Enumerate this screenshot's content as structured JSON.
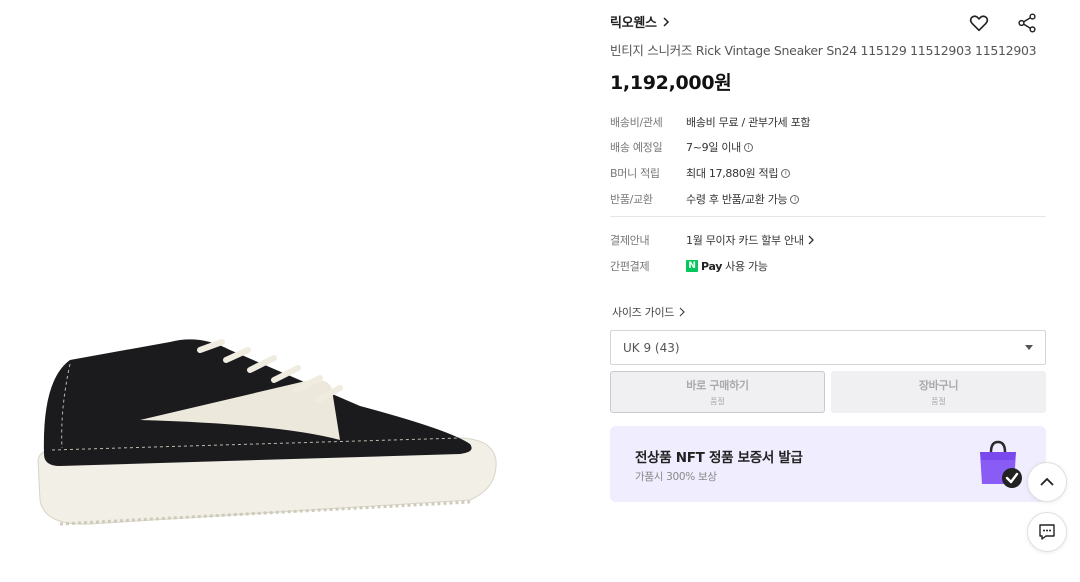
{
  "product": {
    "brand": "릭오웬스",
    "name": "빈티지 스니커즈 Rick Vintage Sneaker Sn24 115129 11512903 11512903",
    "price": "1,192,000원",
    "image_alt": "black leather sneaker with white sole"
  },
  "specs": [
    {
      "key": "배송비/관세",
      "value": "배송비 무료 / 관부가세 포함"
    },
    {
      "key": "배송 예정일",
      "value": "7~9일 이내"
    },
    {
      "key": "B머니 적립",
      "value": "최대 17,880원 적립"
    },
    {
      "key": "반품/교환",
      "value": "수령 후 반품/교환 가능"
    }
  ],
  "payment": {
    "info_key": "결제안내",
    "info_value": "1월 무이자 카드 할부 안내",
    "easy_key": "간편결제",
    "npay_letter": "N",
    "npay_word": "Pay",
    "npay_suffix": "사용 가능"
  },
  "size": {
    "guide_label": "사이즈 가이드",
    "selected": "UK 9 (43)"
  },
  "buttons": {
    "buy_label": "바로 구매하기",
    "buy_sub": "품절",
    "cart_label": "장바구니",
    "cart_sub": "품절"
  },
  "nft": {
    "title": "전상품 NFT 정품 보증서 발급",
    "subtitle": "가품시 300% 보상"
  },
  "colors": {
    "accent_purple": "#8a5cf6",
    "npay_green": "#03c75a",
    "nft_bg": "#f0edfe"
  },
  "icons": {
    "wish": "heart-icon",
    "share": "share-icon",
    "scroll_top": "chevron-up-icon",
    "chat": "chat-icon"
  }
}
